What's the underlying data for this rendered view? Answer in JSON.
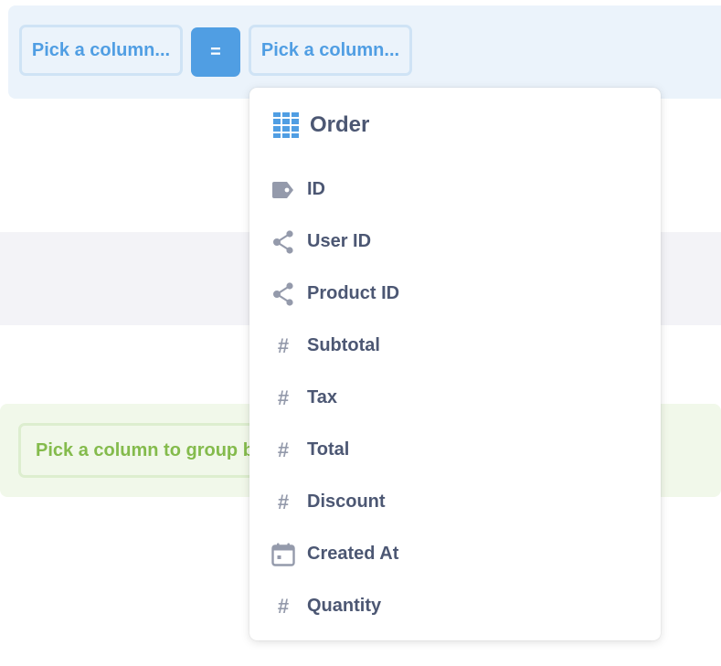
{
  "join": {
    "left_column_label": "Pick a column...",
    "operator": "=",
    "right_column_label": "Pick a column..."
  },
  "group_by": {
    "label": "Pick a column to group by"
  },
  "popover": {
    "title": "Order",
    "title_icon": "table-grid-icon",
    "columns": [
      {
        "label": "ID",
        "icon": "tag-icon"
      },
      {
        "label": "User ID",
        "icon": "connections-icon"
      },
      {
        "label": "Product ID",
        "icon": "connections-icon"
      },
      {
        "label": "Subtotal",
        "icon": "number-icon",
        "glyph": "#"
      },
      {
        "label": "Tax",
        "icon": "number-icon",
        "glyph": "#"
      },
      {
        "label": "Total",
        "icon": "number-icon",
        "glyph": "#"
      },
      {
        "label": "Discount",
        "icon": "number-icon",
        "glyph": "#"
      },
      {
        "label": "Created At",
        "icon": "calendar-icon"
      },
      {
        "label": "Quantity",
        "icon": "number-icon",
        "glyph": "#"
      }
    ]
  },
  "colors": {
    "brand": "#509ee3",
    "text": "#4c5773",
    "icon": "#949aab",
    "summarize_green": "#84bb4c"
  }
}
